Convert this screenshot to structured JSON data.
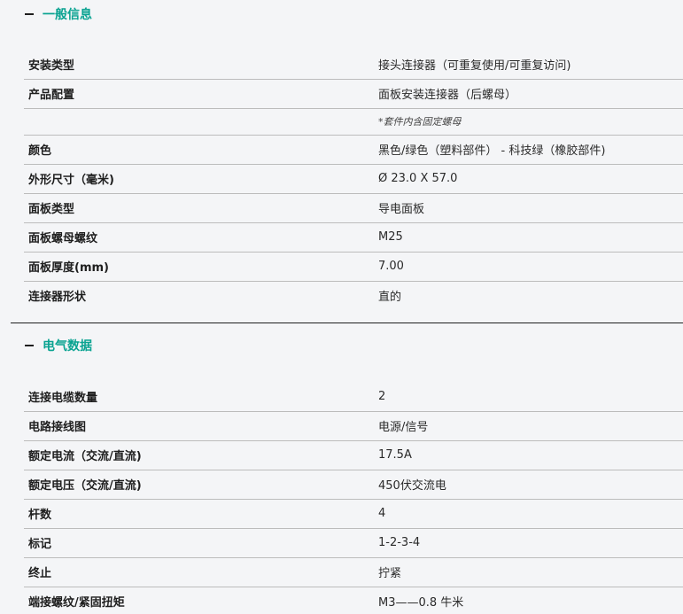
{
  "general": {
    "title": "一般信息",
    "rows": [
      {
        "label": "安装类型",
        "value": "接头连接器（可重复使用/可重复访问)"
      },
      {
        "label": "产品配置",
        "value": "面板安装连接器（后螺母）"
      },
      {
        "label": "",
        "value": "*套件内含固定螺母"
      },
      {
        "label": "颜色",
        "value": "黑色/绿色（塑料部件） - 科技绿（橡胶部件)"
      },
      {
        "label": "外形尺寸（毫米)",
        "value": "Ø 23.0 X 57.0"
      },
      {
        "label": "面板类型",
        "value": "导电面板"
      },
      {
        "label": "面板螺母螺纹",
        "value": "M25"
      },
      {
        "label": "面板厚度(mm)",
        "value": "7.00"
      },
      {
        "label": "连接器形状",
        "value": "直的"
      }
    ]
  },
  "electrical": {
    "title": "电气数据",
    "rows": [
      {
        "label": "连接电缆数量",
        "value": "2"
      },
      {
        "label": "电路接线图",
        "value": "电源/信号"
      },
      {
        "label": "额定电流（交流/直流)",
        "value": "17.5A"
      },
      {
        "label": "额定电压（交流/直流)",
        "value": "450伏交流电"
      },
      {
        "label": "杆数",
        "value": "4"
      },
      {
        "label": "标记",
        "value": "1-2-3-4"
      },
      {
        "label": "终止",
        "value": "拧紧"
      },
      {
        "label": "端接螺纹/紧固扭矩",
        "value": "M3——0.8 牛米"
      }
    ]
  }
}
